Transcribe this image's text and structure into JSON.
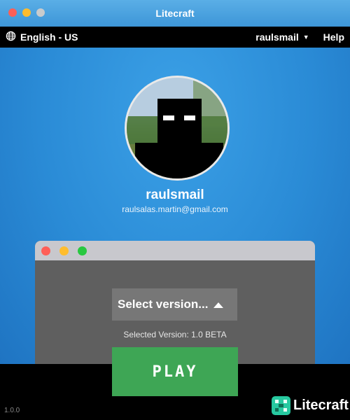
{
  "window": {
    "title": "Litecraft"
  },
  "topbar": {
    "language": "English - US",
    "account": "raulsmail",
    "help": "Help"
  },
  "profile": {
    "username": "raulsmail",
    "email": "raulsalas.martin@gmail.com"
  },
  "launcher": {
    "version_select_label": "Select version...",
    "selected_version_text": "Selected Version: 1.0 BETA",
    "play_label": "PLAY"
  },
  "footer": {
    "version": "1.0.0",
    "brand": "Litecraft"
  },
  "colors": {
    "accent_blue": "#2a8bd6",
    "play_green": "#3ea655",
    "brand_teal": "#27c9a0"
  },
  "icons": {
    "language": "globe-icon",
    "account_menu": "caret-down-icon",
    "version_toggle": "caret-up-icon"
  }
}
